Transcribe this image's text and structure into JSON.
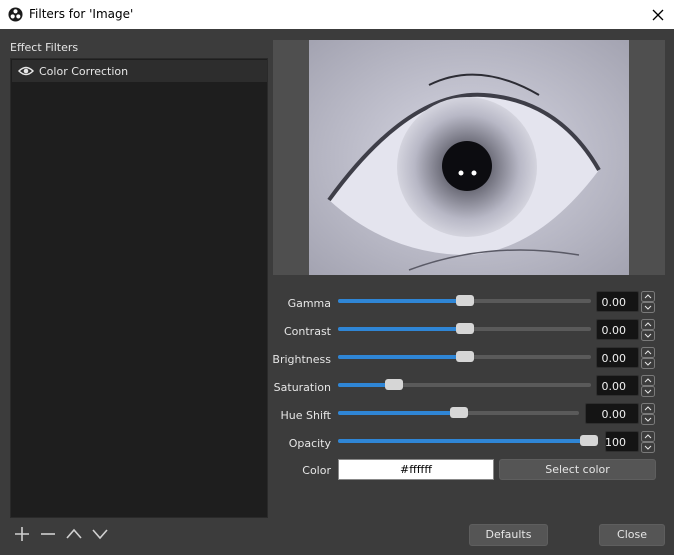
{
  "window": {
    "title": "Filters for 'Image'"
  },
  "filters": {
    "section_label": "Effect Filters",
    "items": [
      {
        "label": "Color Correction",
        "visible": true
      }
    ]
  },
  "preview": {
    "description_icon": "eye-photo"
  },
  "properties": {
    "gamma": {
      "label": "Gamma",
      "value": "0.00",
      "level": 0.5
    },
    "contrast": {
      "label": "Contrast",
      "value": "0.00",
      "level": 0.5
    },
    "brightness": {
      "label": "Brightness",
      "value": "0.00",
      "level": 0.5
    },
    "saturation": {
      "label": "Saturation",
      "value": "0.00",
      "level": 0.2
    },
    "hue_shift": {
      "label": "Hue Shift",
      "value": "0.00",
      "level": 0.5
    },
    "opacity": {
      "label": "Opacity",
      "value": "100",
      "level": 1.0
    },
    "color": {
      "label": "Color",
      "value": "#ffffff",
      "select_label": "Select color"
    }
  },
  "buttons": {
    "defaults": "Defaults",
    "close": "Close"
  },
  "colors": {
    "accent": "#2f86d6",
    "background": "#3c3c3c",
    "list_bg": "#1e1e1e"
  },
  "icons": {
    "add": "plus-icon",
    "remove": "minus-icon",
    "move_up": "chevron-up-icon",
    "move_down": "chevron-down-icon"
  }
}
